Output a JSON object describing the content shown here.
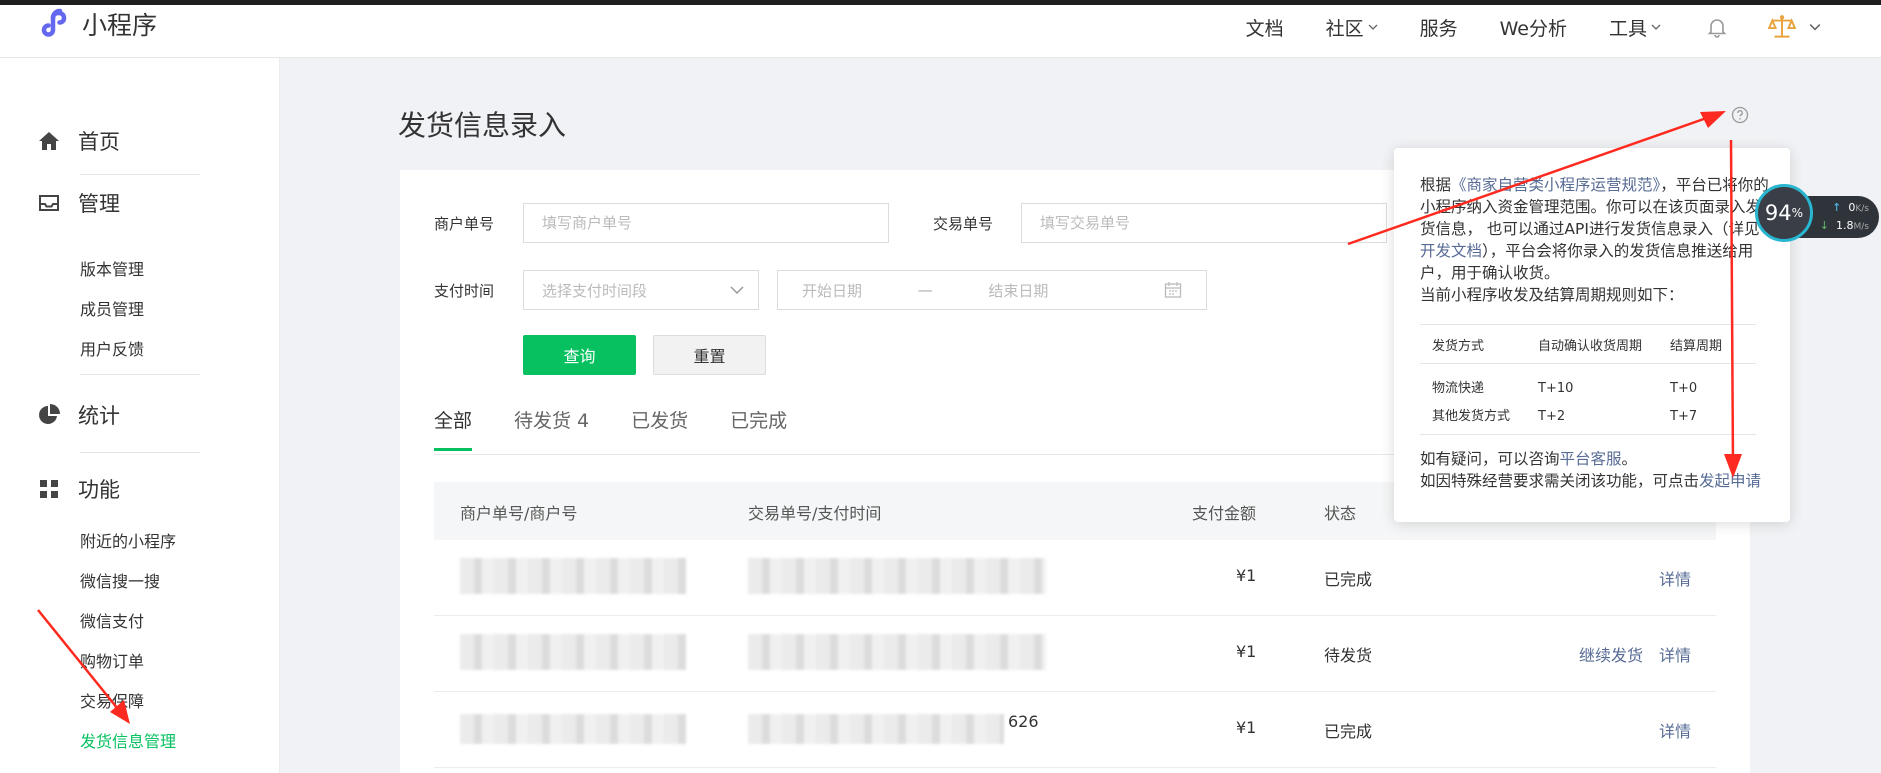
{
  "header": {
    "app_name": "小程序",
    "nav": [
      {
        "label": "文档",
        "has_dropdown": false
      },
      {
        "label": "社区",
        "has_dropdown": true
      },
      {
        "label": "服务",
        "has_dropdown": false
      },
      {
        "label": "We分析",
        "has_dropdown": false
      },
      {
        "label": "工具",
        "has_dropdown": true
      }
    ],
    "icons": [
      "bell-icon",
      "scale-icon",
      "chevron-down-icon"
    ]
  },
  "sidebar": {
    "groups": [
      {
        "label": "首页",
        "icon": "home-icon"
      },
      {
        "label": "管理",
        "icon": "inbox-icon",
        "items": [
          "版本管理",
          "成员管理",
          "用户反馈"
        ]
      },
      {
        "label": "统计",
        "icon": "pie-chart-icon"
      },
      {
        "label": "功能",
        "icon": "grid-icon",
        "items": [
          "附近的小程序",
          "微信搜一搜",
          "微信支付",
          "购物订单",
          "交易保障",
          "发货信息管理"
        ]
      }
    ],
    "active_item": "发货信息管理"
  },
  "page": {
    "title": "发货信息录入"
  },
  "filters": {
    "merchant_no_label": "商户单号",
    "merchant_no_placeholder": "填写商户单号",
    "trade_no_label": "交易单号",
    "trade_no_placeholder": "填写交易单号",
    "pay_time_label": "支付时间",
    "pay_time_placeholder": "选择支付时间段",
    "start_date": "开始日期",
    "date_sep": "—",
    "end_date": "结束日期",
    "query_button": "查询",
    "reset_button": "重置"
  },
  "tabs": [
    {
      "label": "全部",
      "active": true
    },
    {
      "label": "待发货 4",
      "active": false
    },
    {
      "label": "已发货",
      "active": false
    },
    {
      "label": "已完成",
      "active": false
    }
  ],
  "table": {
    "columns": [
      "商户单号/商户号",
      "交易单号/支付时间",
      "支付金额",
      "状态"
    ],
    "rows": [
      {
        "trade_tail": "",
        "amount": "¥1",
        "status": "已完成",
        "actions": [
          "详情"
        ]
      },
      {
        "trade_tail": "",
        "amount": "¥1",
        "status": "待发货",
        "actions": [
          "继续发货",
          "详情"
        ]
      },
      {
        "trade_tail": "626",
        "amount": "¥1",
        "status": "已完成",
        "actions": [
          "详情"
        ]
      }
    ]
  },
  "popover": {
    "intro_prefix": "根据",
    "rule_link": "《商家自营类小程序运营规范》",
    "intro_rest": "，平台已将你的小程序纳入资金管理范围。你可以在该页面录入发货信息，  也可以通过API进行发货信息录入（详见",
    "doc_link": "开发文档",
    "intro_end": "），平台会将你录入的发货信息推送给用户，用于确认收货。",
    "cycle_title": "当前小程序收发及结算周期规则如下：",
    "columns": [
      "发货方式",
      "自动确认收货周期",
      "结算周期"
    ],
    "rows": [
      [
        "物流快递",
        "T+10",
        "T+0"
      ],
      [
        "其他发货方式",
        "T+2",
        "T+7"
      ]
    ],
    "question_prefix": "如有疑问，可以咨询",
    "service_link": "平台客服",
    "question_end": "。",
    "close_prefix": "如因特殊经营要求需关闭该功能，可点击",
    "apply_link": "发起申请"
  },
  "net_widget": {
    "percent": "94",
    "percent_unit": "%",
    "up_speed": "0",
    "up_unit": "K/s",
    "down_speed": "1.8",
    "down_unit": "M/s"
  },
  "colors": {
    "accent": "#07c160",
    "link": "#576b95",
    "annotation_arrow": "#ff2a1f"
  }
}
